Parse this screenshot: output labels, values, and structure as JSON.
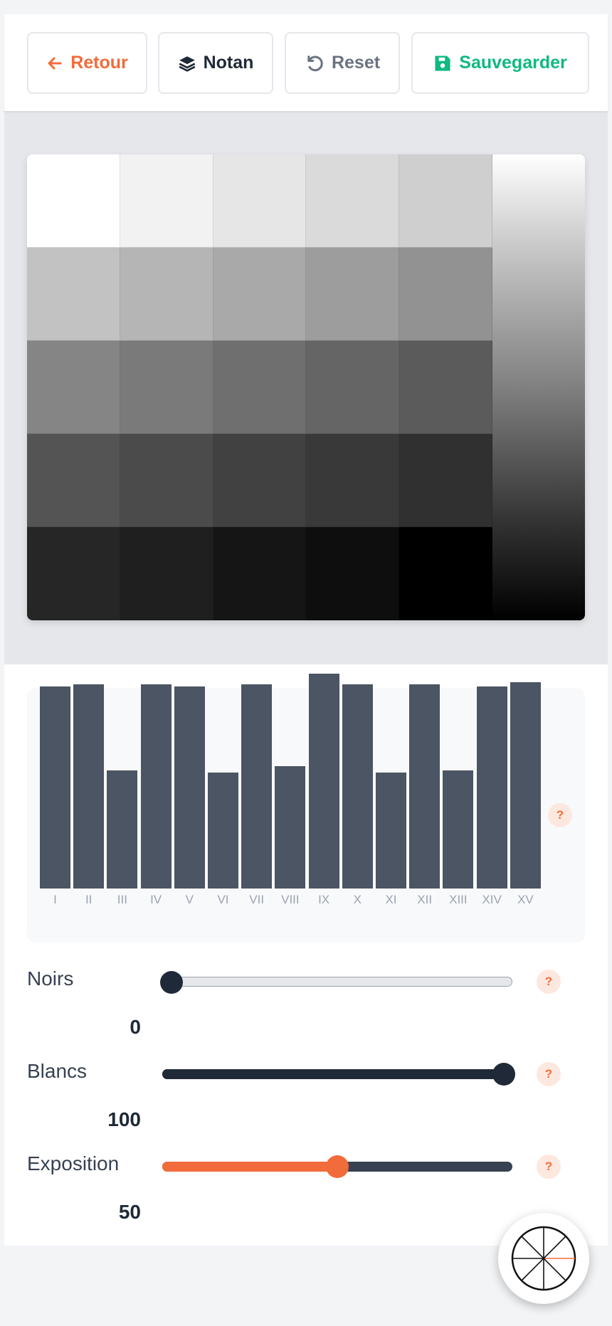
{
  "toolbar": {
    "back_label": "Retour",
    "notan_label": "Notan",
    "reset_label": "Reset",
    "save_label": "Sauvegarder"
  },
  "colors": {
    "accent": "#f26b3a",
    "save": "#10b981",
    "dark": "#1f2937",
    "muted": "#6b7280",
    "bar": "#4b5563"
  },
  "value_scale": {
    "swatches": [
      "#ffffff",
      "#f2f2f2",
      "#e6e6e6",
      "#dadada",
      "#cfcfcf",
      "#c2c2c2",
      "#b5b5b5",
      "#a9a9a9",
      "#9d9d9d",
      "#929292",
      "#858585",
      "#7a7a7a",
      "#6f6f6f",
      "#656565",
      "#5b5b5b",
      "#545454",
      "#4b4b4b",
      "#414141",
      "#393939",
      "#303030",
      "#262626",
      "#1f1f1f",
      "#151515",
      "#0e0e0e",
      "#000000"
    ]
  },
  "histogram": {
    "labels": [
      "I",
      "II",
      "III",
      "IV",
      "V",
      "VI",
      "VII",
      "VIII",
      "IX",
      "X",
      "XI",
      "XII",
      "XIII",
      "XIV",
      "XV"
    ],
    "values": [
      94,
      95,
      55,
      95,
      94,
      54,
      95,
      57,
      100,
      95,
      54,
      95,
      55,
      94,
      96
    ],
    "help_label": "?"
  },
  "sliders": [
    {
      "label": "Noirs",
      "value": "0",
      "fraction": 0.0,
      "help": "?"
    },
    {
      "label": "Blancs",
      "value": "100",
      "fraction": 1.0,
      "help": "?"
    },
    {
      "label": "Exposition",
      "value": "50",
      "fraction": 0.5,
      "help": "?"
    }
  ],
  "fab_icon": "color-wheel-icon"
}
